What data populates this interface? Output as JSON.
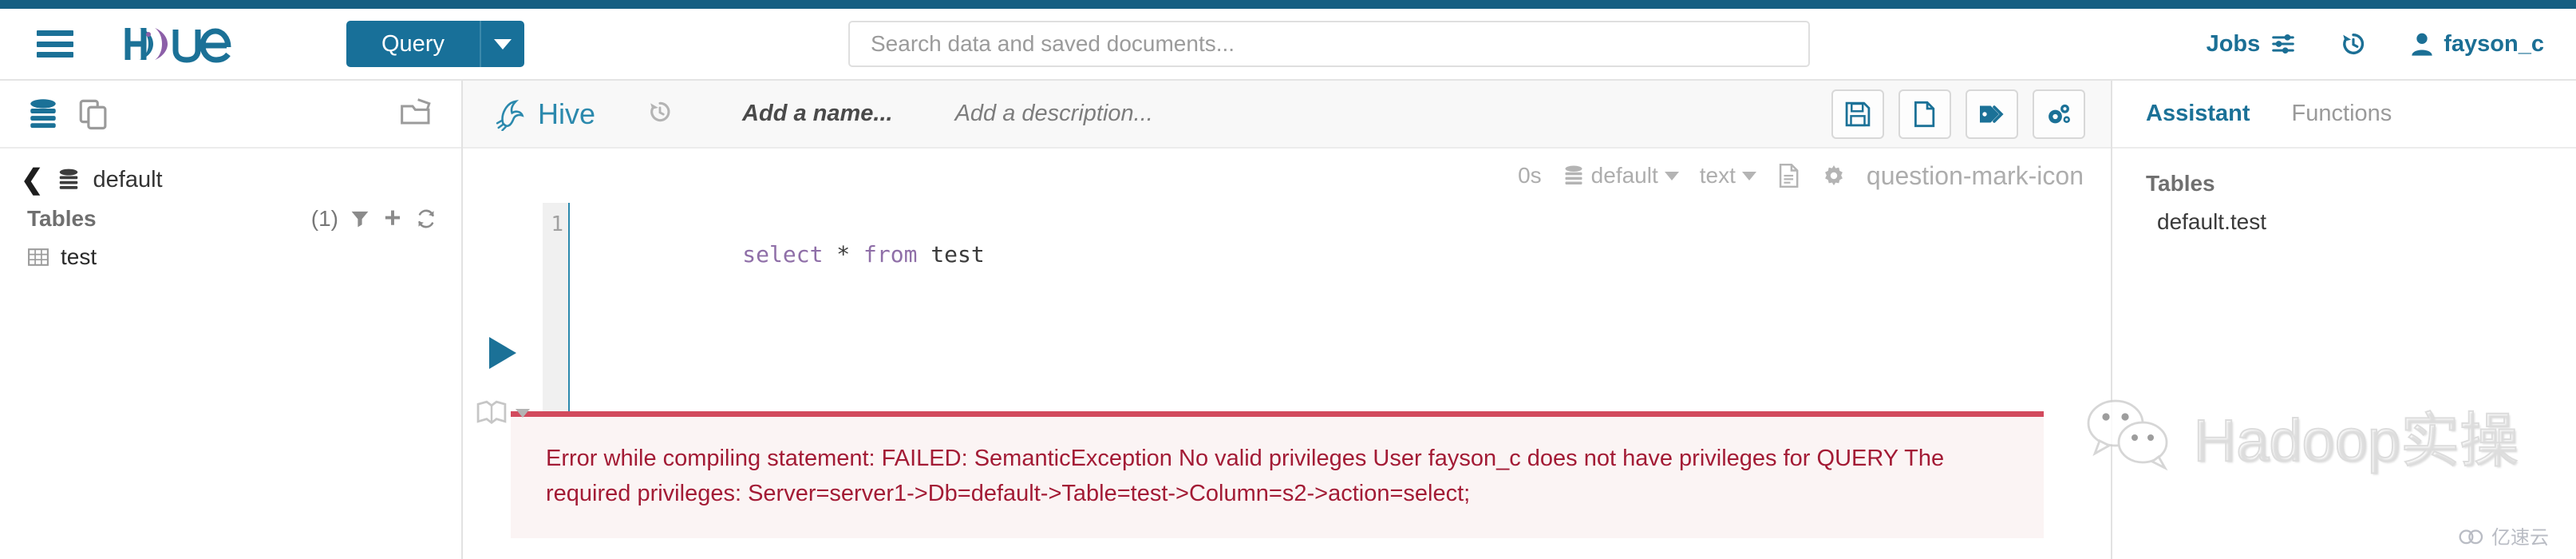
{
  "brand": {
    "name": "Hue",
    "accent": "#187099",
    "topstrip": "#165f82"
  },
  "navbar": {
    "hamburger_icon": "hamburger-menu-icon",
    "logo_icon": "hue-logo",
    "query_button": "Query",
    "query_caret_icon": "chevron-down-icon",
    "search_placeholder": "Search data and saved documents...",
    "search_value": "",
    "jobs_label": "Jobs",
    "jobs_icon": "sliders-icon",
    "history_icon": "history-clock-icon",
    "user_icon": "user-icon",
    "user_name": "fayson_c"
  },
  "left_panel": {
    "head_icons": [
      "database-icon",
      "documents-icon",
      "folder-open-icon"
    ],
    "back_icon": "chevron-left-icon",
    "database_icon": "database-icon",
    "database_name": "default",
    "tables_label": "Tables",
    "tables_count": "(1)",
    "filter_icon": "filter-icon",
    "add_icon": "plus-icon",
    "refresh_icon": "refresh-icon",
    "items": [
      {
        "icon": "table-grid-icon",
        "label": "test"
      }
    ]
  },
  "editor": {
    "engine_icon": "hive-bee-icon",
    "engine_name": "Hive",
    "history_icon": "history-clock-icon",
    "name_placeholder": "Add a name...",
    "description_placeholder": "Add a description...",
    "actions": [
      {
        "icon": "save-icon",
        "name": "save-button"
      },
      {
        "icon": "new-document-icon",
        "name": "new-query-button"
      },
      {
        "icon": "tag-icon",
        "name": "tags-button"
      },
      {
        "icon": "gears-icon",
        "name": "settings-button"
      }
    ],
    "subbar": {
      "elapsed": "0s",
      "database_icon": "database-icon",
      "database": "default",
      "format": "text",
      "caret_icon": "chevron-down-icon",
      "log_icon": "document-lines-icon",
      "settings_icon": "gear-icon",
      "help_icon": "question-mark-icon"
    },
    "run_icon": "play-triangle-icon",
    "book_icon": "book-icon",
    "book_caret_icon": "chevron-down-icon",
    "gutter": [
      "1"
    ],
    "code_tokens": [
      {
        "t": "select",
        "k": true
      },
      {
        "t": " * ",
        "k": false
      },
      {
        "t": "from",
        "k": true
      },
      {
        "t": " test",
        "k": false
      }
    ],
    "code_text": "select * from test"
  },
  "error": {
    "line1": "Error while compiling statement: FAILED: SemanticException No valid privileges User fayson_c does not have privileges for QUERY The",
    "line2": "required privileges: Server=server1->Db=default->Table=test->Column=s2->action=select;",
    "accent": "#d24a5d",
    "text_color": "#a31b35"
  },
  "right_panel": {
    "tabs": [
      {
        "label": "Assistant",
        "active": true
      },
      {
        "label": "Functions",
        "active": false
      }
    ],
    "section_title": "Tables",
    "entries": [
      "default.test"
    ]
  },
  "watermark": {
    "icon": "wechat-icon",
    "text": "Hadoop实操",
    "footer_icon": "cloud-icon",
    "footer_text": "亿速云"
  }
}
